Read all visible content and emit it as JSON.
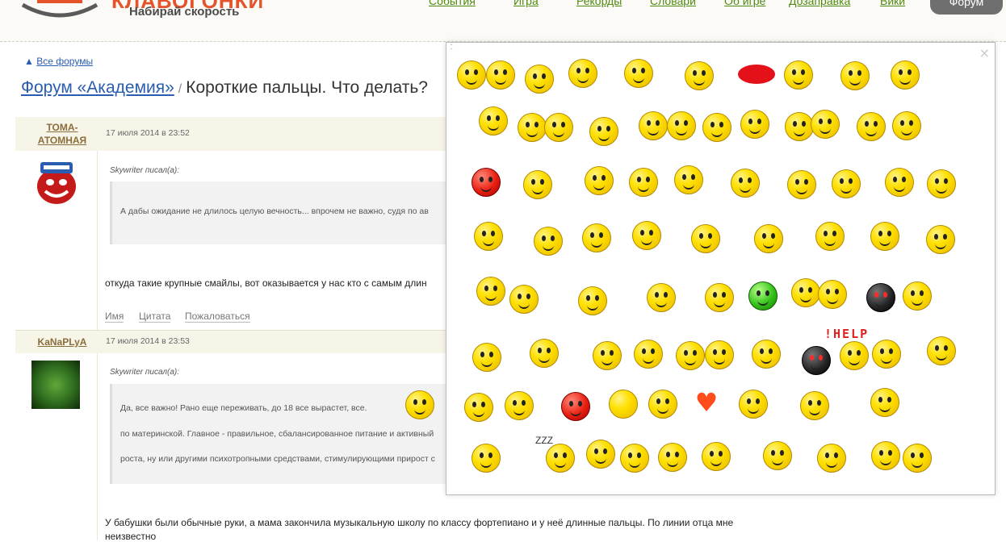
{
  "header": {
    "logo_text": "КЛАВОГОНКИ",
    "tagline": "Набирай скорость",
    "nav": [
      "События",
      "Игра",
      "Рекорды",
      "Словари",
      "Об игре",
      "Дозаправка",
      "Вики"
    ],
    "active_tab": "Форум"
  },
  "breadcrumb": {
    "arrow": "▲",
    "all_forums": "Все форумы"
  },
  "title": {
    "forum_link": "Форум «Академия»",
    "separator": "/",
    "topic": "Короткие пальцы. Что делать?"
  },
  "posts": [
    {
      "author": "ТОМА-АТОМНАЯ",
      "date": "17 июля 2014 в 23:52",
      "quote_by": "Skywriter писал(а):",
      "quote_lines": [
        "А дабы ожидание не длилось целую вечность... впрочем не важно, судя по ав"
      ],
      "text": "откуда такие крупные смайлы, вот оказывается у нас кто с самым длин",
      "actions": [
        "Имя",
        "Цитата",
        "Пожаловаться"
      ]
    },
    {
      "author": "KaNaPLyA",
      "date": "17 июля 2014 в 23:53",
      "quote_by": "Skywriter писал(а):",
      "quote_lines": [
        "Да, все важно! Рано еще переживать, до 18 все вырастет, все.",
        "по материнской. Главное - правильное, сбалансированное питание и активный",
        "роста, ну или другими психотропными средствами, стимулирующими прирост с"
      ],
      "text": "У бабушки были обычные руки, а мама закончила музыкальную школу по классу фортепиано и у неё длинные пальцы. По линии отца мне",
      "text_line2": "неизвестно"
    }
  ],
  "smiley_popup": {
    "close_label": "×",
    "help_label": "!HELP",
    "zzz_label": "ZZZ"
  }
}
